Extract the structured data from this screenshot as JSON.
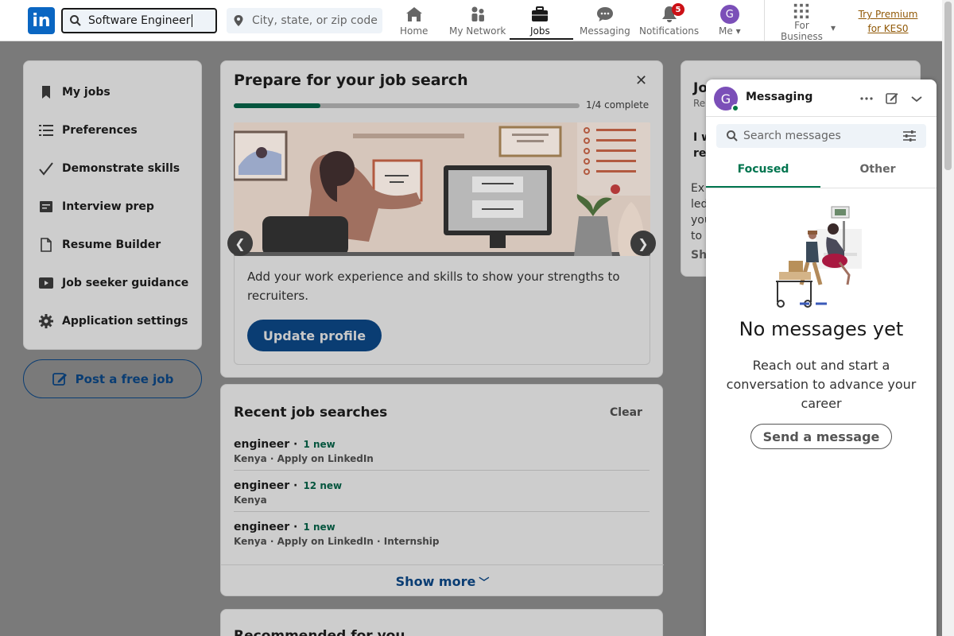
{
  "nav": {
    "search_value": "Software Engineer",
    "location_placeholder": "City, state, or zip code",
    "items": [
      {
        "label": "Home"
      },
      {
        "label": "My Network"
      },
      {
        "label": "Jobs"
      },
      {
        "label": "Messaging"
      },
      {
        "label": "Notifications",
        "badge": "5"
      },
      {
        "label": "Me",
        "avatar_letter": "G"
      },
      {
        "label_line1": "For",
        "label_line2": "Business"
      }
    ],
    "premium_line1": "Try Premium",
    "premium_line2": "for KES0"
  },
  "left": {
    "items": [
      {
        "label": "My jobs",
        "icon": "bookmark-icon"
      },
      {
        "label": "Preferences",
        "icon": "list-icon"
      },
      {
        "label": "Demonstrate skills",
        "icon": "check-icon"
      },
      {
        "label": "Interview prep",
        "icon": "notepad-icon"
      },
      {
        "label": "Resume Builder",
        "icon": "document-icon"
      },
      {
        "label": "Job seeker guidance",
        "icon": "video-icon"
      },
      {
        "label": "Application settings",
        "icon": "gear-icon"
      }
    ],
    "post_job": "Post a free job"
  },
  "prepare": {
    "title": "Prepare for your job search",
    "progress_label": "1/4 complete",
    "progress_fraction": 0.25,
    "body": "Add your work experience and skills to show your strengths to recruiters.",
    "button": "Update profile",
    "prev": "❮",
    "next": "❯",
    "close": "✕"
  },
  "recent": {
    "title": "Recent job searches",
    "clear": "Clear",
    "rows": [
      {
        "query": "engineer ·",
        "new": "1 new",
        "meta": "Kenya · Apply on LinkedIn"
      },
      {
        "query": "engineer ·",
        "new": "12 new",
        "meta": "Kenya"
      },
      {
        "query": "engineer ·",
        "new": "1 new",
        "meta": "Kenya · Apply on LinkedIn · Internship"
      }
    ],
    "show_more": "Show more"
  },
  "recommended": {
    "title": "Recommended for you"
  },
  "right_card": {
    "f1": "Jo",
    "f2": "Re",
    "f3": "I w",
    "f4": "re",
    "f5": "Ex",
    "f6": "led",
    "f7": "you",
    "f8": "to l",
    "f9": "Sh"
  },
  "messaging": {
    "avatar_letter": "G",
    "title": "Messaging",
    "search_placeholder": "Search messages",
    "tabs": [
      {
        "label": "Focused"
      },
      {
        "label": "Other"
      }
    ],
    "empty_title": "No messages yet",
    "empty_sub": "Reach out and start a conversation to advance your career",
    "send_button": "Send a message"
  },
  "colors": {
    "brand": "#0a66c2",
    "accent_green": "#01754f",
    "badge_red": "#cc1016",
    "premium": "#915907"
  }
}
